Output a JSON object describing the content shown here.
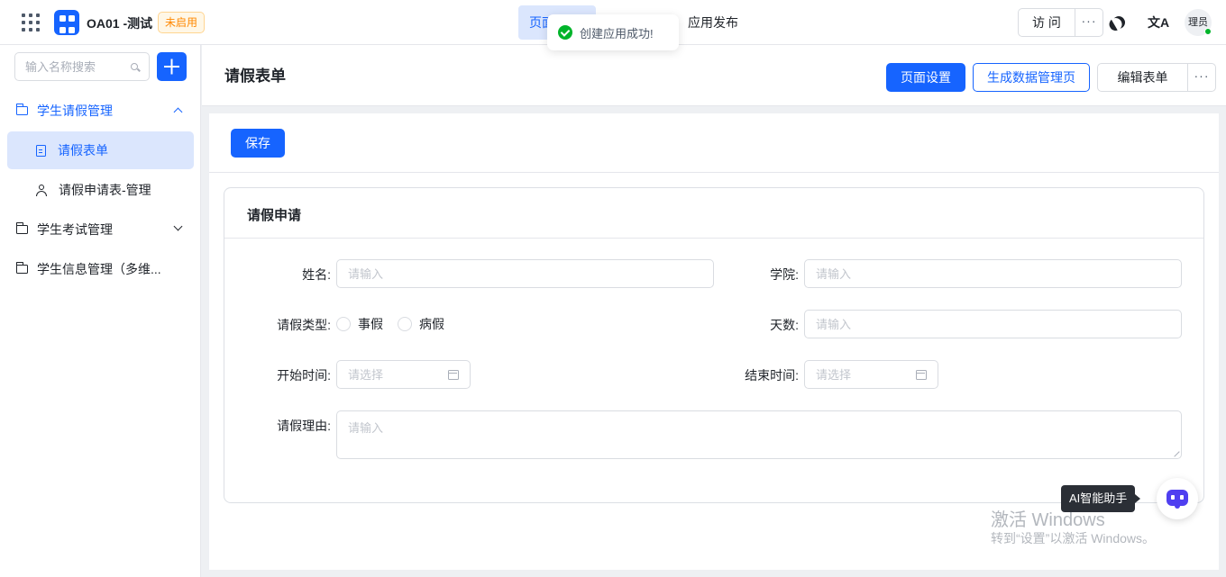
{
  "app": {
    "name": "OA01 -测试",
    "status": "未启用"
  },
  "nav": {
    "tab_page": "页面",
    "tab_publish": "应用发布"
  },
  "toast": {
    "message": "创建应用成功!"
  },
  "topright": {
    "visit": "访 问",
    "more": "···",
    "translate_glyph": "文A",
    "avatar_text": "理员"
  },
  "sidebar": {
    "search_placeholder": "输入名称搜索",
    "items": [
      {
        "label": "学生请假管理"
      },
      {
        "label": "请假表单"
      },
      {
        "label": "请假申请表-管理"
      },
      {
        "label": "学生考试管理"
      },
      {
        "label": "学生信息管理（多维..."
      }
    ]
  },
  "header": {
    "title": "请假表单",
    "page_settings": "页面设置",
    "generate_page": "生成数据管理页",
    "edit_form": "编辑表单",
    "more": "···"
  },
  "content": {
    "save": "保存",
    "card_title": "请假申请",
    "fields": {
      "name_label": "姓名:",
      "name_placeholder": "请输入",
      "college_label": "学院:",
      "college_placeholder": "请输入",
      "type_label": "请假类型:",
      "type_option1": "事假",
      "type_option2": "病假",
      "days_label": "天数:",
      "days_placeholder": "请输入",
      "start_label": "开始时间:",
      "start_placeholder": "请选择",
      "end_label": "结束时间:",
      "end_placeholder": "请选择",
      "reason_label": "请假理由:",
      "reason_placeholder": "请输入"
    }
  },
  "ai": {
    "tooltip": "AI智能助手"
  },
  "watermark": {
    "line1": "激活 Windows",
    "line2": "转到“设置”以激活 Windows。"
  },
  "colors": {
    "primary": "#1664ff",
    "success": "#00b42a",
    "warning": "#ff8800",
    "ai": "#4f3ff0"
  }
}
